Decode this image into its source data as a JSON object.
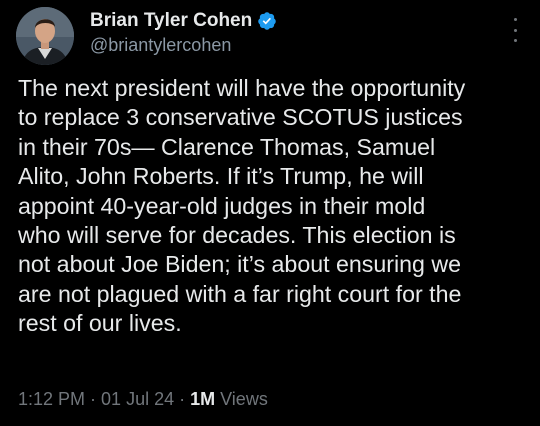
{
  "author": {
    "display_name": "Brian Tyler Cohen",
    "handle": "@briantylercohen",
    "verified_icon": "verified-badge-icon",
    "accent_color": "#1d9bf0"
  },
  "tweet": {
    "text": "The next president will have the opportunity\nto replace 3 conservative SCOTUS justices\nin their 70s— Clarence Thomas, Samuel\nAlito, John Roberts. If it’s Trump, he will\nappoint 40-year-old judges in their mold\nwho will serve for decades. This election is\nnot about Joe Biden; it’s about ensuring we\nare not plagued with a far right court for the\nrest of our lives."
  },
  "meta": {
    "time": "1:12 PM",
    "separator": " · ",
    "date": "01 Jul 24",
    "views_count": "1M",
    "views_label": " Views"
  },
  "menu": {
    "icon": "more-vertical-icon"
  }
}
